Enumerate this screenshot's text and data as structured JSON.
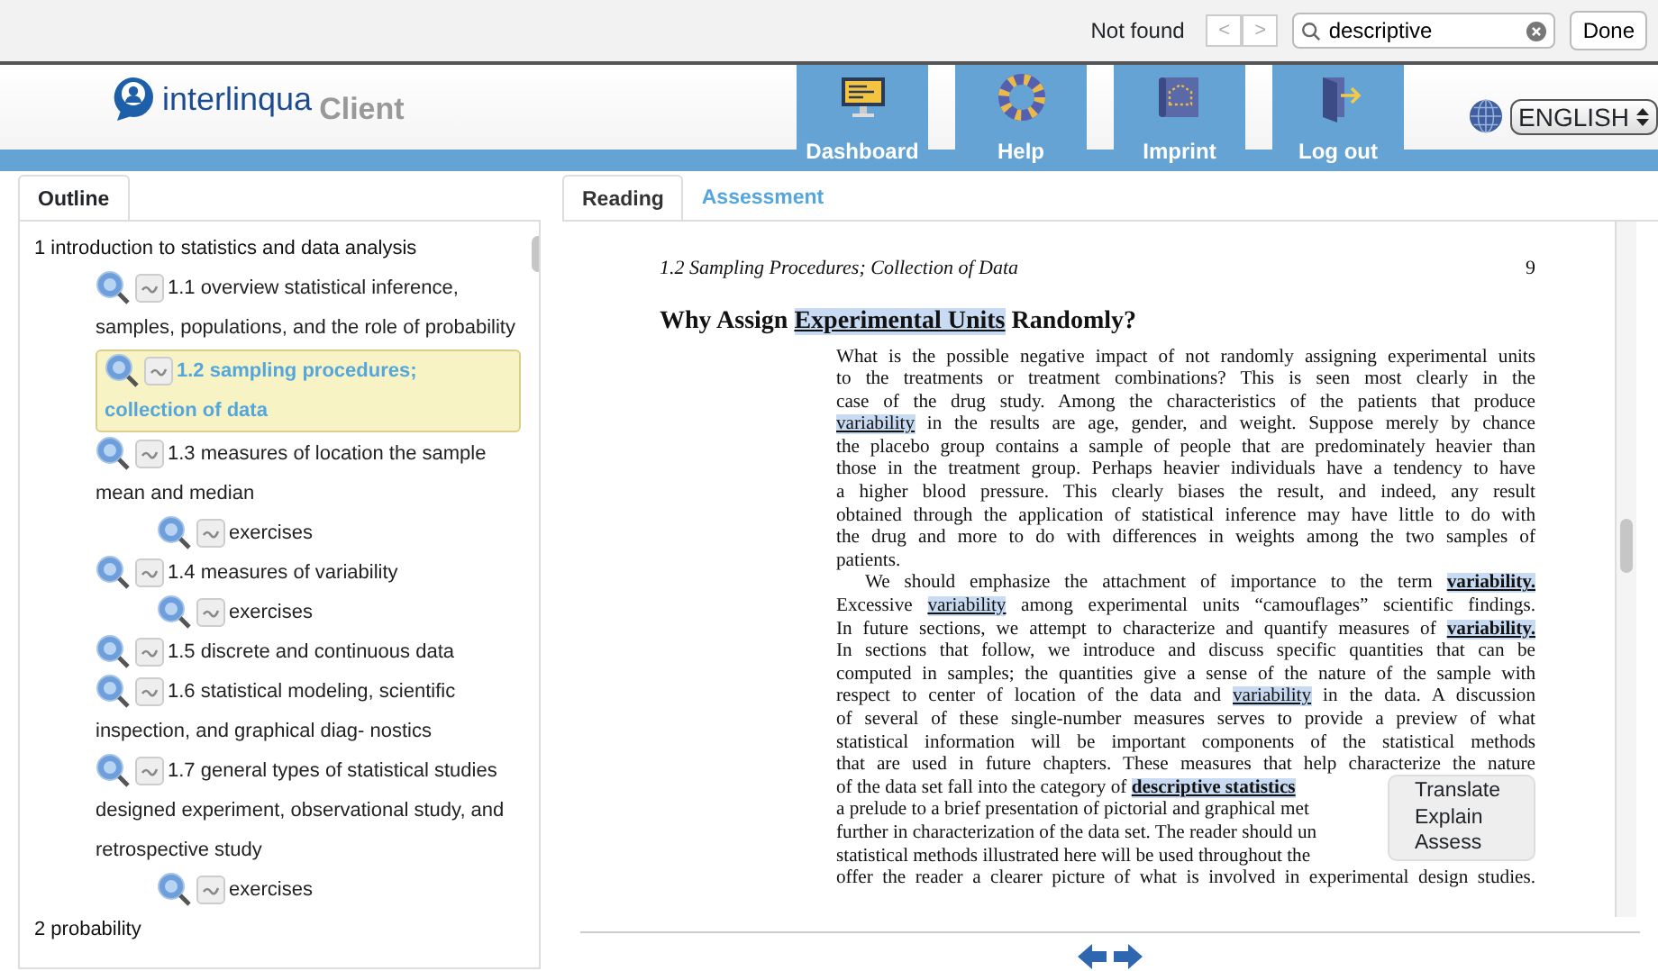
{
  "find_bar": {
    "status": "Not found",
    "prev": "<",
    "next": ">",
    "search": {
      "value": "descriptive"
    },
    "done": "Done"
  },
  "header": {
    "logo_name": "interlinqua",
    "logo_suffix": "Client",
    "nav": [
      {
        "label": "Dashboard",
        "kind": "monitor"
      },
      {
        "label": "Help",
        "kind": "ring"
      },
      {
        "label": "Imprint",
        "kind": "map"
      },
      {
        "label": "Log out",
        "kind": "door"
      }
    ],
    "language": "ENGLISH"
  },
  "outline": {
    "tab": "Outline",
    "items": [
      {
        "label": "1 introduction to statistics and data analysis",
        "kind": "chapter",
        "selected": false,
        "children": [
          {
            "label": "1.1 overview statistical inference, samples, populations, and the role of probability",
            "kind": "section",
            "selected": false
          },
          {
            "label": "1.2 sampling procedures; collection of data",
            "kind": "section",
            "selected": true
          },
          {
            "label": "1.3 measures of location the sample mean and median",
            "kind": "section",
            "selected": false,
            "children": [
              {
                "label": "exercises",
                "kind": "section",
                "selected": false
              }
            ]
          },
          {
            "label": "1.4 measures of variability",
            "kind": "section",
            "selected": false,
            "children": [
              {
                "label": "exercises",
                "kind": "section",
                "selected": false
              }
            ]
          },
          {
            "label": "1.5 discrete and continuous data",
            "kind": "section",
            "selected": false
          },
          {
            "label": "1.6 statistical modeling, scientific inspection, and graphical diag- nostics",
            "kind": "section",
            "selected": false
          },
          {
            "label": "1.7 general types of statistical studies designed experiment, observational study, and retrospective study",
            "kind": "section",
            "selected": false,
            "children": [
              {
                "label": "exercises",
                "kind": "section",
                "selected": false
              }
            ]
          }
        ]
      },
      {
        "label": "2 probability",
        "kind": "chapter",
        "selected": false
      }
    ]
  },
  "reader": {
    "tabs": [
      {
        "label": "Reading",
        "selected": true
      },
      {
        "label": "Assessment",
        "selected": false
      }
    ],
    "running_head": "1.2  Sampling Procedures; Collection of Data",
    "page_number": "9",
    "heading": [
      {
        "text": "Why Assign ",
        "term": false,
        "bold": true
      },
      {
        "text": "Experimental Units",
        "term": true,
        "bold": true
      },
      {
        "text": " Randomly?",
        "term": false,
        "bold": true
      }
    ],
    "lines": [
      {
        "kind": "justified",
        "segments": [
          {
            "text": "What is the possible negative impact of not randomly assigning experimental units",
            "term": false,
            "bold": false
          }
        ]
      },
      {
        "kind": "justified",
        "segments": [
          {
            "text": "to the treatments or treatment combinations?  This is seen most clearly in the",
            "term": false,
            "bold": false
          }
        ]
      },
      {
        "kind": "justified",
        "segments": [
          {
            "text": "case of the drug study.  Among the characteristics of the patients that produce",
            "term": false,
            "bold": false
          }
        ]
      },
      {
        "kind": "justified",
        "segments": [
          {
            "text": "variability",
            "term": true,
            "bold": false
          },
          {
            "text": " in the results are age, gender, and weight.  Suppose merely by chance",
            "term": false,
            "bold": false
          }
        ]
      },
      {
        "kind": "justified",
        "segments": [
          {
            "text": "the placebo group contains a sample of people that are predominately heavier than",
            "term": false,
            "bold": false
          }
        ]
      },
      {
        "kind": "justified",
        "segments": [
          {
            "text": "those in the treatment group. Perhaps heavier individuals have a tendency to have",
            "term": false,
            "bold": false
          }
        ]
      },
      {
        "kind": "justified",
        "segments": [
          {
            "text": "a higher blood pressure.  This clearly biases the result, and indeed, any result",
            "term": false,
            "bold": false
          }
        ]
      },
      {
        "kind": "justified",
        "segments": [
          {
            "text": "obtained through the application of statistical inference may have little to do with",
            "term": false,
            "bold": false
          }
        ]
      },
      {
        "kind": "justified",
        "segments": [
          {
            "text": "the drug and more to do with differences in weights among the two samples of",
            "term": false,
            "bold": false
          }
        ]
      },
      {
        "kind": "end",
        "segments": [
          {
            "text": "patients.",
            "term": false,
            "bold": false
          }
        ]
      },
      {
        "kind": "indented",
        "segments": [
          {
            "text": "We should emphasize the attachment of importance to the term ",
            "term": false,
            "bold": false
          },
          {
            "text": "variability.",
            "term": true,
            "bold": true
          }
        ]
      },
      {
        "kind": "justified",
        "segments": [
          {
            "text": "Excessive ",
            "term": false,
            "bold": false
          },
          {
            "text": "variability",
            "term": true,
            "bold": false
          },
          {
            "text": " among experimental units “camouflages” scientific findings.",
            "term": false,
            "bold": false
          }
        ]
      },
      {
        "kind": "justified",
        "segments": [
          {
            "text": "In future sections, we attempt to characterize and quantify measures of ",
            "term": false,
            "bold": false
          },
          {
            "text": "variability.",
            "term": true,
            "bold": true
          }
        ]
      },
      {
        "kind": "justified",
        "segments": [
          {
            "text": "In sections that follow, we introduce and discuss specific quantities that can be",
            "term": false,
            "bold": false
          }
        ]
      },
      {
        "kind": "justified",
        "segments": [
          {
            "text": "computed in samples; the quantities give a sense of the nature of the sample with",
            "term": false,
            "bold": false
          }
        ]
      },
      {
        "kind": "justified",
        "segments": [
          {
            "text": "respect to center of location of the data and ",
            "term": false,
            "bold": false
          },
          {
            "text": "variability",
            "term": true,
            "bold": false
          },
          {
            "text": " in the data.  A discussion",
            "term": false,
            "bold": false
          }
        ]
      },
      {
        "kind": "justified",
        "segments": [
          {
            "text": "of several of these single-number measures serves to provide a preview of what",
            "term": false,
            "bold": false
          }
        ]
      },
      {
        "kind": "justified",
        "segments": [
          {
            "text": "statistical information will be important components of the statistical methods",
            "term": false,
            "bold": false
          }
        ]
      },
      {
        "kind": "justified",
        "segments": [
          {
            "text": "that are used in future chapters. These measures that help characterize the nature",
            "term": false,
            "bold": false
          }
        ]
      },
      {
        "kind": "covered",
        "segments": [
          {
            "text": "of the data set fall into the category of ",
            "term": false,
            "bold": false
          },
          {
            "text": "descriptive statistics",
            "term": true,
            "bold": true
          }
        ]
      },
      {
        "kind": "covered",
        "segments": [
          {
            "text": "a prelude to a brief presentation of pictorial and graphical met",
            "term": false,
            "bold": false
          }
        ]
      },
      {
        "kind": "covered",
        "segments": [
          {
            "text": "further in characterization of the data set. The reader should un",
            "term": false,
            "bold": false
          }
        ]
      },
      {
        "kind": "covered",
        "segments": [
          {
            "text": "statistical methods illustrated here will be used throughout the",
            "term": false,
            "bold": false
          }
        ]
      },
      {
        "kind": "justified",
        "segments": [
          {
            "text": "offer the reader a clearer picture of what is involved in experimental design studies.",
            "term": false,
            "bold": false
          }
        ]
      }
    ],
    "context_menu": [
      "Translate",
      "Explain",
      "Assess"
    ]
  }
}
